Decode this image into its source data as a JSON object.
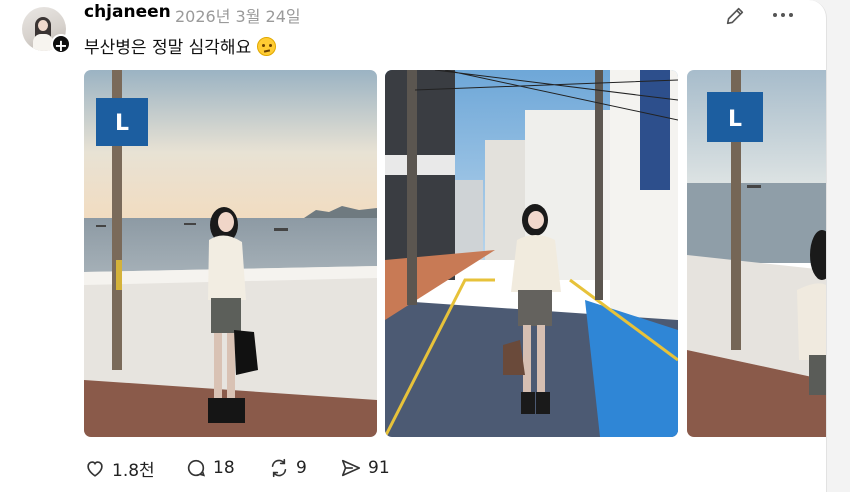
{
  "post": {
    "username": "chjaneen",
    "timestamp": "2026년 3월 24일",
    "text": "부산병은 정말 심각해요",
    "emoji_icon": "woozy-face-emoji"
  },
  "images": [
    {
      "name": "photo-seaside-wall"
    },
    {
      "name": "photo-street-alley"
    },
    {
      "name": "photo-seaside-wall-2"
    }
  ],
  "sign_letter": "L",
  "stats": {
    "likes": "1.8천",
    "replies": "18",
    "reposts": "9",
    "shares": "91"
  },
  "icons": [
    "edit-icon",
    "more-icon",
    "heart-icon",
    "comment-icon",
    "repost-icon",
    "share-icon",
    "plus-icon"
  ],
  "colors": {
    "background": "#ffffff",
    "text": "#0f0f0f",
    "muted": "#9a9a9a"
  }
}
